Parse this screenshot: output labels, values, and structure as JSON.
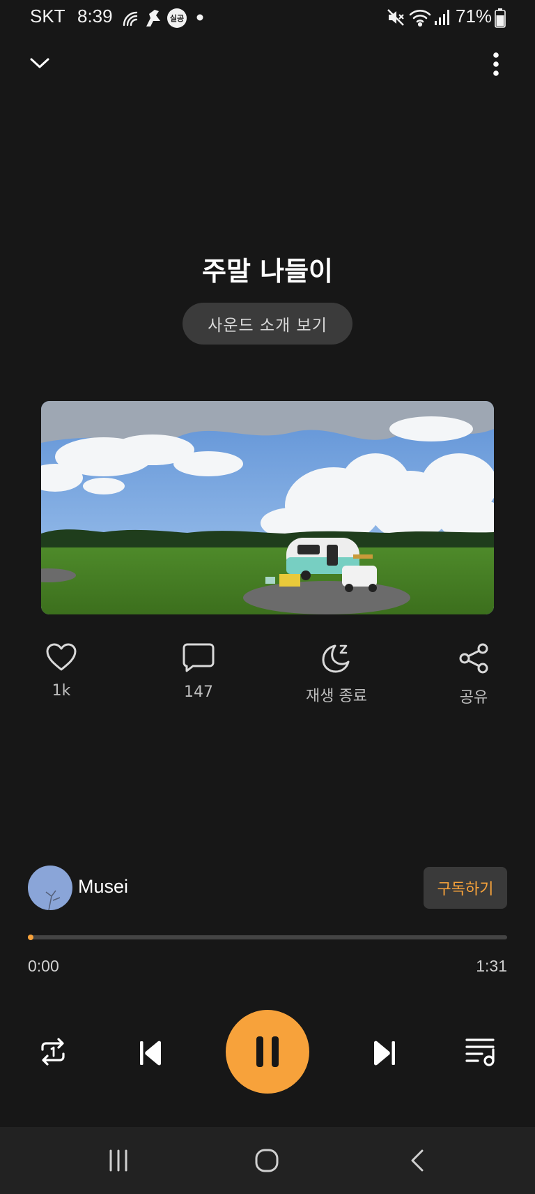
{
  "status_bar": {
    "carrier": "SKT",
    "time": "8:39",
    "badge": "실공",
    "battery": "71%",
    "icons": [
      "wifi-calling-icon",
      "notification-app-icon",
      "chat-badge-icon",
      "dot-icon",
      "mute-icon",
      "wifi-icon",
      "signal-icon",
      "battery-icon"
    ]
  },
  "header": {
    "icons": [
      "chevron-down-icon",
      "more-vert-icon"
    ]
  },
  "main": {
    "title": "주말 나들이",
    "intro_button": "사운드 소개 보기"
  },
  "actions": [
    {
      "icon": "heart-icon",
      "label": "1k"
    },
    {
      "icon": "comment-icon",
      "label": "147"
    },
    {
      "icon": "sleep-timer-icon",
      "label": "재생 종료"
    },
    {
      "icon": "share-icon",
      "label": "공유"
    }
  ],
  "creator": {
    "name": "Musei",
    "subscribe_label": "구독하기"
  },
  "player": {
    "current_time": "0:00",
    "total_time": "1:31",
    "progress": 0.0,
    "accent_color": "#f7a23b",
    "controls": [
      "repeat-one-icon",
      "previous-icon",
      "pause-icon",
      "next-icon",
      "playlist-icon"
    ]
  },
  "nav_bar": {
    "icons": [
      "recent-apps-icon",
      "home-icon",
      "back-icon"
    ]
  }
}
